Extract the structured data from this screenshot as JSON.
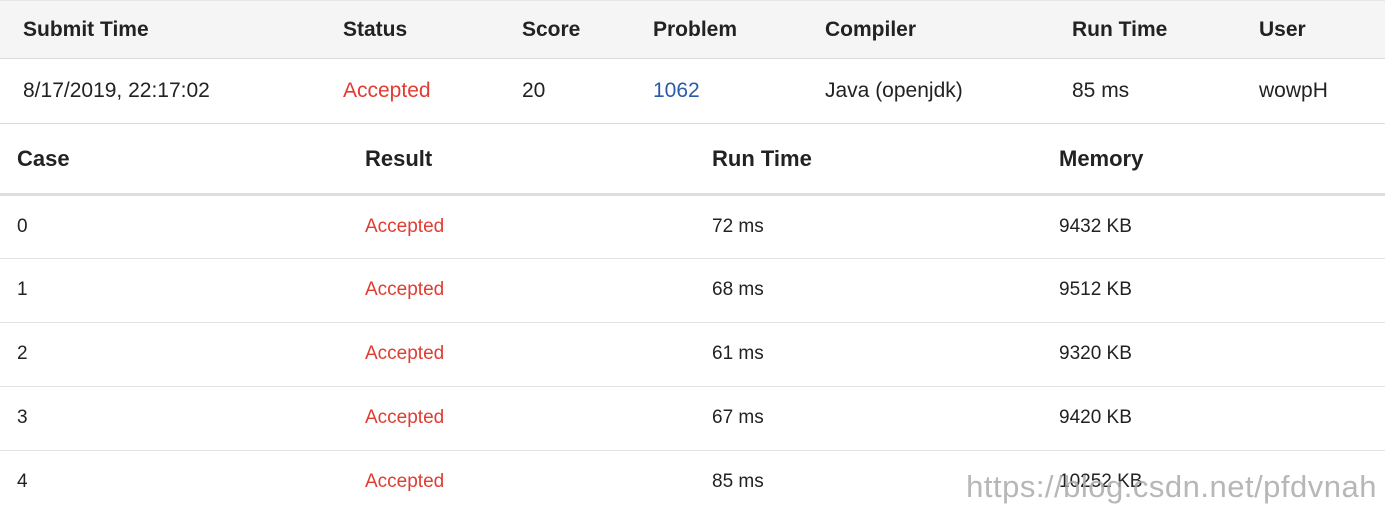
{
  "colors": {
    "accepted": "#e03c31",
    "link": "#2b5aa8",
    "header_bg": "#f5f5f5"
  },
  "submission": {
    "headers": [
      "Submit Time",
      "Status",
      "Score",
      "Problem",
      "Compiler",
      "Run Time",
      "User"
    ],
    "row": {
      "submit_time": "8/17/2019, 22:17:02",
      "status": "Accepted",
      "score": "20",
      "problem": "1062",
      "compiler": "Java (openjdk)",
      "run_time": "85 ms",
      "user": "wowpH"
    }
  },
  "cases": {
    "headers": [
      "Case",
      "Result",
      "Run Time",
      "Memory"
    ],
    "rows": [
      {
        "case": "0",
        "result": "Accepted",
        "run_time": "72 ms",
        "memory": "9432 KB"
      },
      {
        "case": "1",
        "result": "Accepted",
        "run_time": "68 ms",
        "memory": "9512 KB"
      },
      {
        "case": "2",
        "result": "Accepted",
        "run_time": "61 ms",
        "memory": "9320 KB"
      },
      {
        "case": "3",
        "result": "Accepted",
        "run_time": "67 ms",
        "memory": "9420 KB"
      },
      {
        "case": "4",
        "result": "Accepted",
        "run_time": "85 ms",
        "memory": "10252 KB"
      }
    ]
  },
  "watermark": "https://blog.csdn.net/pfdvnah"
}
